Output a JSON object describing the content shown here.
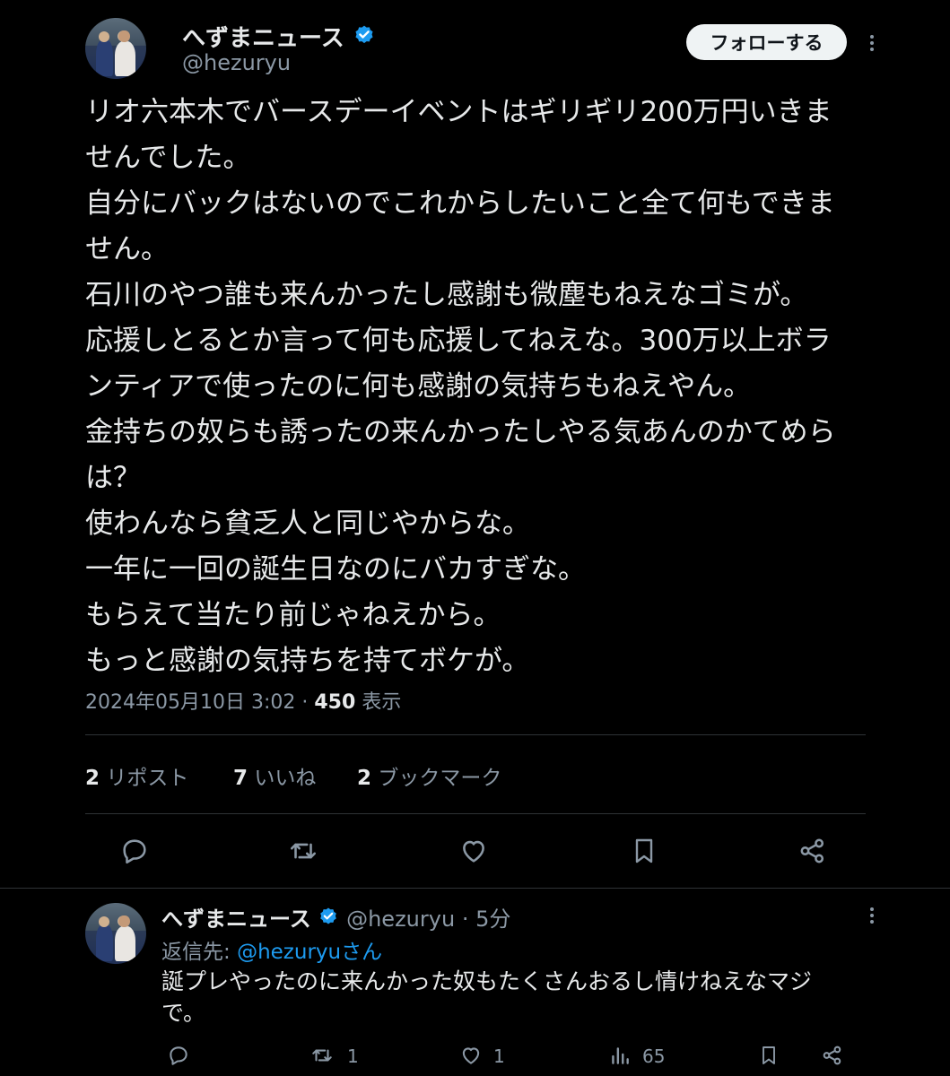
{
  "main_post": {
    "author_name": "へずまニュース",
    "author_handle": "@hezuryu",
    "follow_label": "フォローする",
    "text_lines": [
      "リオ六本木でバースデーイベントはギリギリ200万円いきま",
      "せんでした。",
      "自分にバックはないのでこれからしたいこと全て何もできま",
      "せん。",
      "石川のやつ誰も来んかったし感謝も微塵もねえなゴミが。",
      "応援しとるとか言って何も応援してねえな。300万以上ボラ",
      "ンティアで使ったのに何も感謝の気持ちもねえやん。",
      "金持ちの奴らも誘ったの来んかったしやる気あんのかてめら",
      "は？",
      "使わんなら貧乏人と同じやからな。",
      "一年に一回の誕生日なのにバカすぎな。",
      "もらえて当たり前じゃねえから。",
      "もっと感謝の気持ちを持てボケが。"
    ],
    "timestamp": "2024年05月10日 3:02",
    "separator": "·",
    "views_count": "450",
    "views_label": "表示",
    "stats": {
      "reposts_count": "2",
      "reposts_label": "リポスト",
      "likes_count": "7",
      "likes_label": "いいね",
      "bookmarks_count": "2",
      "bookmarks_label": "ブックマーク"
    }
  },
  "reply_post": {
    "author_name": "へずまニュース",
    "author_handle": "@hezuryu",
    "separator": "·",
    "time_ago": "5分",
    "reply_to_prefix": "返信先:",
    "reply_to_handle": "@hezuryuさん",
    "text_lines": [
      "誕プレやったのに来んかった奴もたくさんおるし情けねえなマジ",
      "で。"
    ],
    "repost_count": "1",
    "like_count": "1",
    "views_count": "65"
  },
  "icons": {
    "verified": "verified-badge-icon",
    "more": "more-icon",
    "reply": "reply-icon",
    "repost": "repost-icon",
    "like": "heart-icon",
    "bookmark": "bookmark-icon",
    "share": "share-icon",
    "views": "bar-chart-icon"
  },
  "colors": {
    "background": "#000000",
    "text": "#e7e9ea",
    "secondary": "#8b98a5",
    "accent": "#1d9bf0",
    "divider": "#2f3336"
  }
}
